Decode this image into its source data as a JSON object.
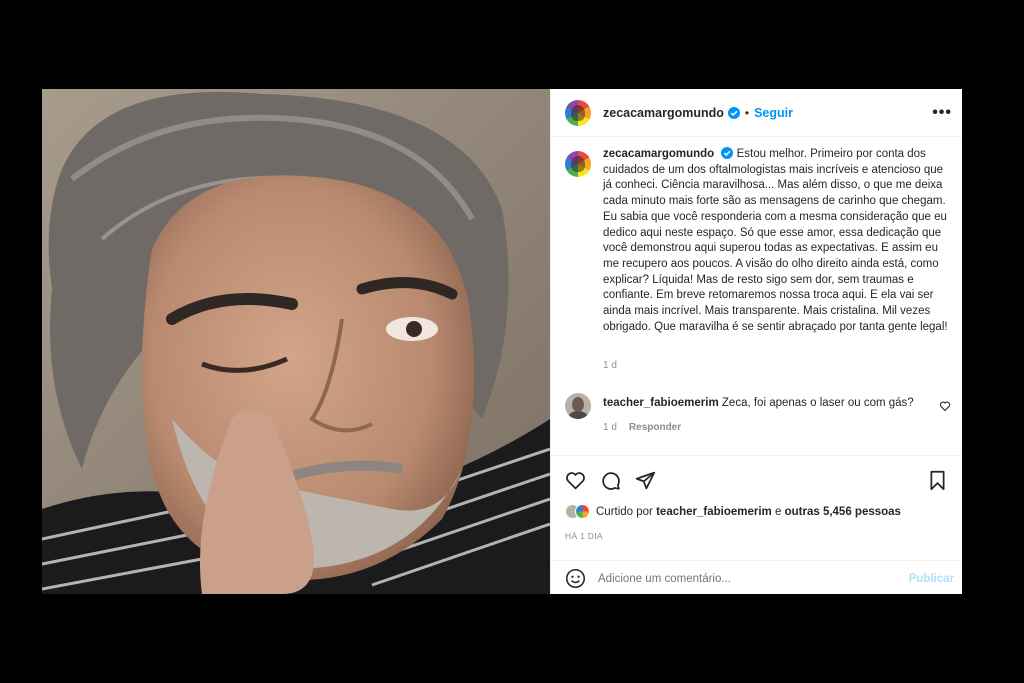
{
  "post": {
    "username": "zecacamargomundo",
    "dot": "•",
    "follow_label": "Seguir",
    "more_label": "•••",
    "caption_text": "Estou melhor. Primeiro por conta dos cuidados de um dos oftalmologistas mais incríveis e atencioso que já conheci. Ciência maravilhosa... Mas além disso, o que me deixa cada minuto mais forte são as mensagens de carinho que chegam. Eu sabia que você responderia com a mesma consideração que eu dedico aqui neste espaço. Só que esse amor, essa dedicação que você demonstrou aqui superou todas as expectativas. E assim eu me recupero aos poucos. A visão do olho direito ainda está, como explicar? Líquida! Mas de resto sigo sem dor, sem traumas e confiante. Em breve retomaremos nossa troca aqui. E ela vai ser ainda mais incrível. Mais transparente. Mais cristalina. Mil vezes obrigado. Que maravilha é se sentir abraçado por tanta gente legal!",
    "caption_age": "1 d"
  },
  "comment": {
    "username": "teacher_fabioemerim",
    "text": "Zeca, foi apenas o laser ou com gás?",
    "age": "1 d",
    "reply_label": "Responder"
  },
  "likes": {
    "prefix": "Curtido por",
    "user": "teacher_fabioemerim",
    "middle": "e",
    "others": "outras 5,456 pessoas"
  },
  "timestamp": "HÁ 1 DIA",
  "add_comment": {
    "placeholder": "Adicione um comentário...",
    "publish_label": "Publicar"
  },
  "icons": {
    "like": "heart-icon",
    "comment": "comment-icon",
    "share": "share-icon",
    "save": "bookmark-icon",
    "emoji": "emoji-icon",
    "verified": "verified-badge-icon"
  },
  "colors": {
    "accent": "#0095f6",
    "publish_disabled": "#b2dffc",
    "muted": "#8e8e8e",
    "text": "#262626"
  }
}
